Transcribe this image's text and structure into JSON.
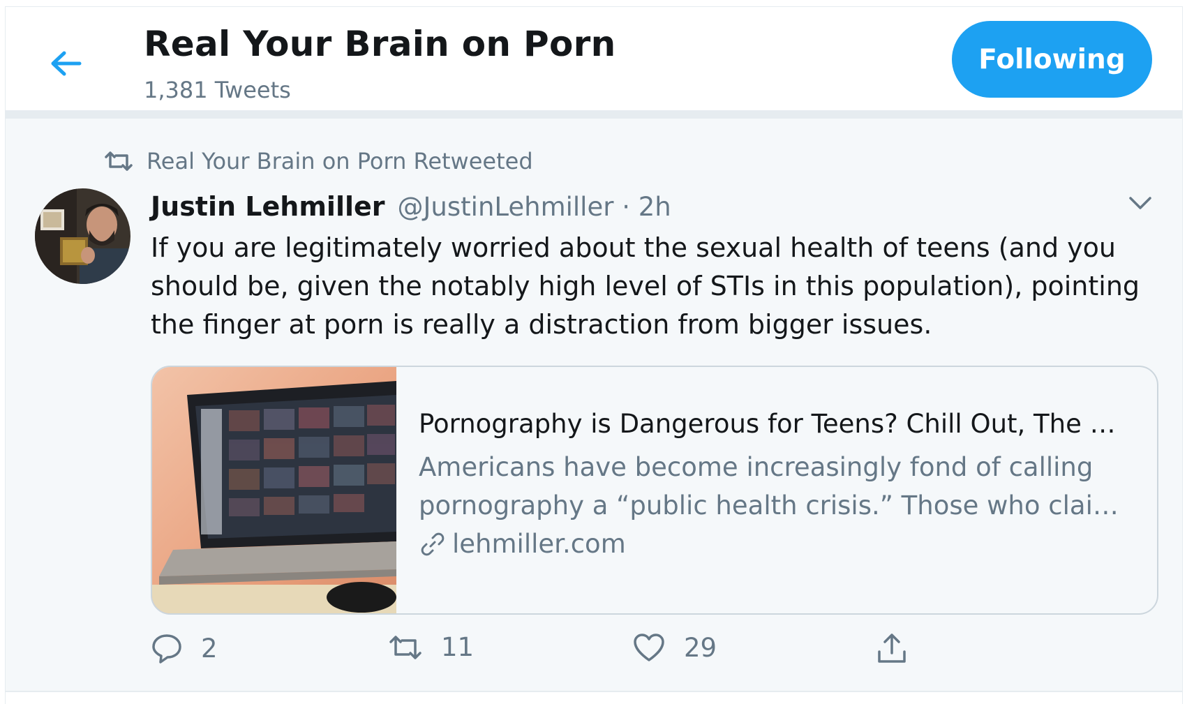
{
  "header": {
    "title": "Real Your Brain on Porn",
    "tweet_count": "1,381 Tweets",
    "follow_label": "Following",
    "accent_color": "#1da1f2"
  },
  "tweet": {
    "retweet_context": "Real Your Brain on Porn Retweeted",
    "author_name": "Justin Lehmiller",
    "author_meta": "@JustinLehmiller · 2h",
    "text": "If you are legitimately worried about the sexual health of teens (and you should be, given the notably high level of STIs in this population), pointing the finger at porn is really a distraction from bigger issues.",
    "card": {
      "title": "Pornography is Dangerous for Teens? Chill Out, The …",
      "description": "Americans have become increasingly fond of calling pornography a “public health crisis.” Those who clai…",
      "domain": "lehmiller.com"
    },
    "actions": {
      "replies": "2",
      "retweets": "11",
      "likes": "29"
    }
  },
  "icons": [
    "back-arrow-icon",
    "retweet-icon",
    "chevron-down-icon",
    "link-icon",
    "reply-icon",
    "heart-icon",
    "share-icon"
  ]
}
